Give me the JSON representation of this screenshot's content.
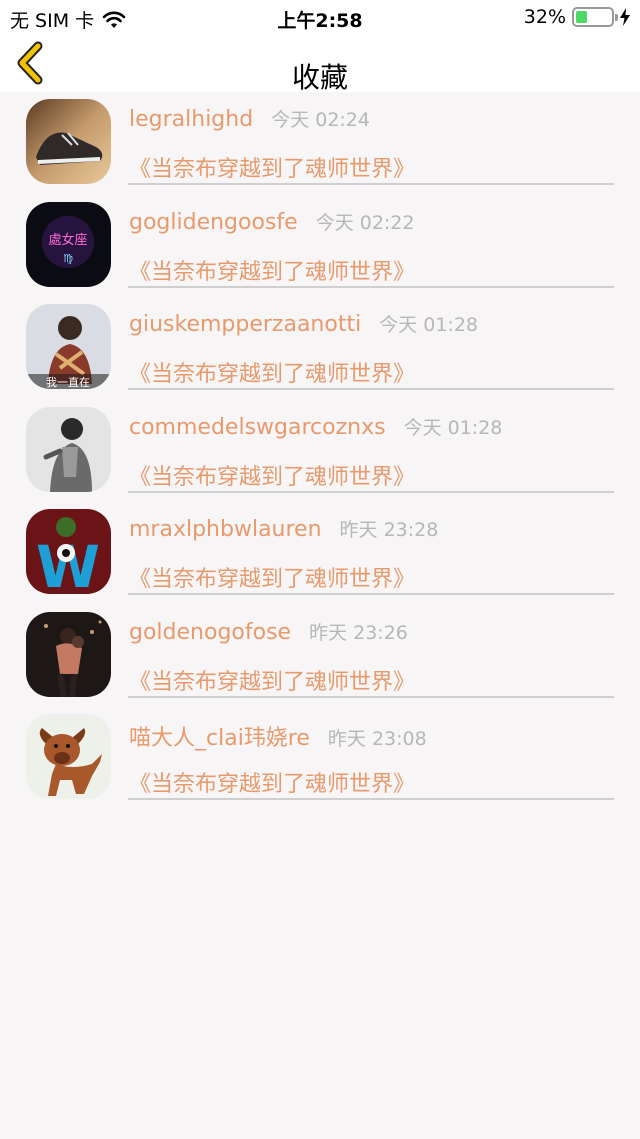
{
  "status_bar": {
    "carrier": "无 SIM 卡",
    "time": "上午2:58",
    "battery_percent": "32%",
    "battery_level": 0.32,
    "wifi_icon": "wifi-icon",
    "charging_icon": "charging-icon"
  },
  "nav": {
    "title": "收藏",
    "back_icon": "chevron-left-icon",
    "back_color": "#f2c200"
  },
  "colors": {
    "accent": "#e89a6c",
    "muted": "#b7b7b7",
    "divider": "#cfcfcf",
    "background": "#f7f5f6"
  },
  "favorites": [
    {
      "username": "legralhighd",
      "time": "今天 02:24",
      "book": "《当奈布穿越到了魂师世界》",
      "avatar": "sneaker"
    },
    {
      "username": "goglidengoosfe",
      "time": "今天 02:22",
      "book": "《当奈布穿越到了魂师世界》",
      "avatar": "neon-text",
      "avatar_text": "處女座"
    },
    {
      "username": "giuskempperzaanotti",
      "time": "今天 01:28",
      "book": "《当奈布穿越到了魂师世界》",
      "avatar": "girl-caption",
      "avatar_text": "我一直在"
    },
    {
      "username": "commedelswgarcoznxs",
      "time": "今天 01:28",
      "book": "《当奈布穿越到了魂师世界》",
      "avatar": "grayscale-portrait"
    },
    {
      "username": "mraxlphbwlauren",
      "time": "昨天 23:28",
      "book": "《当奈布穿越到了魂师世界》",
      "avatar": "letter-w",
      "avatar_text": "W"
    },
    {
      "username": "goldenogofose",
      "time": "昨天 23:26",
      "book": "《当奈布穿越到了魂师世界》",
      "avatar": "couple"
    },
    {
      "username": "喵大人_clai玮娆re",
      "time": "昨天 23:08",
      "book": "《当奈布穿越到了魂师世界》",
      "avatar": "puppy"
    }
  ]
}
